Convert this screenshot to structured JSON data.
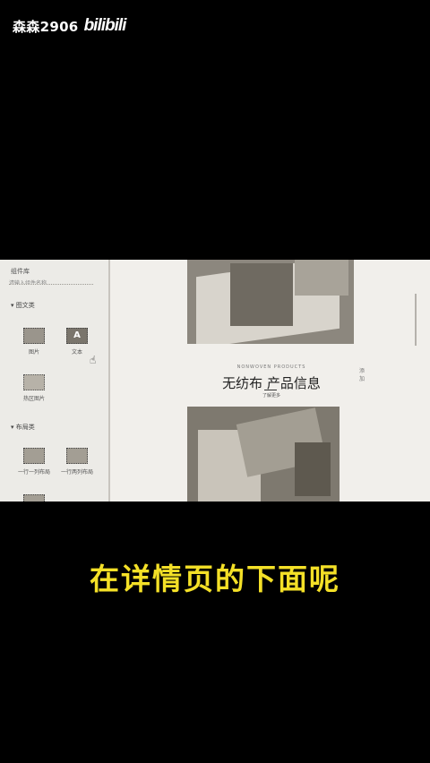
{
  "watermark": {
    "user": "森森2906",
    "logo": "bilibili"
  },
  "sidebar": {
    "title": "组件库",
    "search_placeholder": "请输入组件名称",
    "sections": [
      {
        "label": "▾ 图文类",
        "items": [
          {
            "label": "图片",
            "icon": "image-icon"
          },
          {
            "label": "文本",
            "icon": "text-icon",
            "glyph": "A"
          },
          {
            "label": "热区图片",
            "icon": "hotspot-image-icon"
          }
        ]
      },
      {
        "label": "▾ 布局类",
        "items": [
          {
            "label": "一行一列布局",
            "icon": "one-column-icon"
          },
          {
            "label": "一行两列布局",
            "icon": "two-column-icon"
          },
          {
            "label": "",
            "icon": "three-column-icon"
          }
        ]
      }
    ]
  },
  "canvas": {
    "info_en": "NONWOVEN PRODUCTS",
    "info_title": "无纺布 产品信息",
    "info_sub": "了解更多",
    "side_hint": "添\n加"
  },
  "caption": "在详情页的下面呢"
}
